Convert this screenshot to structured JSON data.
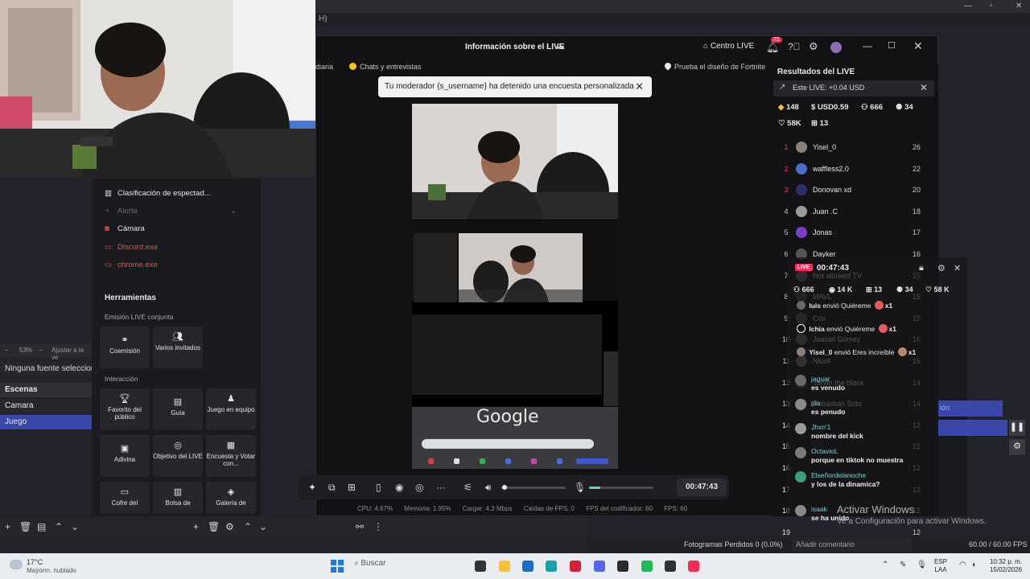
{
  "obs": {
    "menu_fragment": "H)",
    "zoom_value": "53%",
    "zoom_label": "Ajustar a la ve",
    "no_source": "Ninguna fuente seleccionad",
    "scenes_header": "Escenas",
    "scenes": [
      "Camara",
      "Juego"
    ],
    "frames_lost": "Fotogramas Perdidos 0 (0.0%)",
    "fps": "60.00 / 60.00 FPS",
    "right_blue_fragment": "ión"
  },
  "studio": {
    "title": "Información sobre el LIVE",
    "centro_live": "Centro LIVE",
    "notif_count": "71",
    "tags": {
      "diaria": "diaria",
      "chats": "Chats y entrevistas",
      "fortnite": "Prueba el diseño de Fortnite"
    },
    "toast": "Tu moderador {s_username} ha detenido una encuesta personalizada",
    "google_text": "Google",
    "timer": "00:47:43",
    "stats": {
      "cpu": "CPU: 4.67%",
      "memoria": "Memoria: 1.95%",
      "cargar": "Cargar: 4.3 Mbps",
      "caidas": "Caídas de FPS: 0",
      "fps_cod": "FPS del codificador: 60",
      "fps": "FPS: 60"
    }
  },
  "sources": [
    {
      "label": "Clasificación de espectad...",
      "icon": "ranking-icon",
      "color": "#e8e8ea"
    },
    {
      "label": "Alerta",
      "icon": "bell-icon",
      "color": "#6a6a72"
    },
    {
      "label": "Cámara",
      "icon": "camera-icon",
      "color": "#e8e8ea"
    },
    {
      "label": "Discord.exe",
      "icon": "window-icon",
      "color": "#e0504f"
    },
    {
      "label": "chrome.exe",
      "icon": "window-icon",
      "color": "#e0504f"
    }
  ],
  "tools": {
    "title": "Herramientas",
    "section_joint": "Emisión LIVE conjunta",
    "section_interaction": "Interacción",
    "tiles": [
      {
        "label": "Coemisión",
        "icon": "link-icon"
      },
      {
        "label": "Varios invitados",
        "icon": "users-icon"
      },
      {
        "label": "Favorito del público",
        "icon": "trophy-icon"
      },
      {
        "label": "Guía",
        "icon": "guide-icon"
      },
      {
        "label": "Juego en equipo",
        "icon": "team-icon"
      },
      {
        "label": "Adivina",
        "icon": "guess-icon"
      },
      {
        "label": "Objetivo del LIVE",
        "icon": "target-icon"
      },
      {
        "label": "Encuesta y Votar con...",
        "icon": "poll-icon"
      },
      {
        "label": "Cofre del",
        "icon": "chest-icon"
      },
      {
        "label": "Bolsa de",
        "icon": "bag-icon"
      },
      {
        "label": "Galería de",
        "icon": "gallery-icon"
      }
    ]
  },
  "results": {
    "title": "Resultados del LIVE",
    "este_live": "Este LIVE: +0.04 USD",
    "diamonds": "148",
    "usd": "USD0.59",
    "viewers": "666",
    "gifters": "34",
    "likes": "58K",
    "gifts": "13",
    "ranking": [
      {
        "rank": "1",
        "name": "Yisel_0",
        "score": "26",
        "rank_color": "#fe2c55",
        "avatar": "#8a7f7a"
      },
      {
        "rank": "2",
        "name": "waffless2.0",
        "score": "22",
        "rank_color": "#fe2c55",
        "avatar": "#4a6cc8"
      },
      {
        "rank": "3",
        "name": "Donovan xd",
        "score": "20",
        "rank_color": "#fe2c55",
        "avatar": "#2b2f6a"
      },
      {
        "rank": "4",
        "name": "Juan .C",
        "score": "18",
        "rank_color": "#c6c6cc",
        "avatar": "#9a9a9a"
      },
      {
        "rank": "5",
        "name": "Jonas",
        "score": "17",
        "rank_color": "#c6c6cc",
        "avatar": "#7d3fc7"
      },
      {
        "rank": "6",
        "name": "Dayker",
        "score": "16",
        "rank_color": "#c6c6cc",
        "avatar": "#555"
      },
      {
        "rank": "7",
        "name": "Not allowed TV",
        "score": "15",
        "rank_color": "#c6c6cc",
        "avatar": "#666"
      },
      {
        "rank": "8",
        "name": "MAVL",
        "score": "15",
        "rank_color": "#c6c6cc",
        "avatar": "#444"
      },
      {
        "rank": "9",
        "name": "Cris",
        "score": "15",
        "rank_color": "#c6c6cc",
        "avatar": "#555"
      },
      {
        "rank": "10",
        "name": "Jaasiel Gómez",
        "score": "15",
        "rank_color": "#c6c6cc",
        "avatar": "#6a6a6a"
      },
      {
        "rank": "11",
        "name": "Nicoll",
        "score": "15",
        "rank_color": "#c6c6cc",
        "avatar": "#777"
      },
      {
        "rank": "12",
        "name": "Yorvin the black",
        "score": "14",
        "rank_color": "#c6c6cc",
        "avatar": "#555"
      },
      {
        "rank": "13",
        "name": "Sebastián Soto",
        "score": "14",
        "rank_color": "#c6c6cc",
        "avatar": "#666"
      },
      {
        "rank": "14",
        "name": "",
        "score": "12",
        "rank_color": "#c6c6cc",
        "avatar": "#555"
      },
      {
        "rank": "15",
        "name": "",
        "score": "12",
        "rank_color": "#c6c6cc",
        "avatar": "#555"
      },
      {
        "rank": "16",
        "name": "",
        "score": "12",
        "rank_color": "#c6c6cc",
        "avatar": "#555"
      },
      {
        "rank": "17",
        "name": "",
        "score": "12",
        "rank_color": "#c6c6cc",
        "avatar": "#555"
      },
      {
        "rank": "18",
        "name": "",
        "score": "12",
        "rank_color": "#c6c6cc",
        "avatar": "#555"
      },
      {
        "rank": "19",
        "name": "",
        "score": "12",
        "rank_color": "#c6c6cc",
        "avatar": "#555"
      }
    ]
  },
  "chat": {
    "live_badge": "LIVE",
    "time": "00:47:43",
    "viewers": "666",
    "views": "14 K",
    "gifts": "13",
    "gifters": "34",
    "likes": "58 K",
    "gift_events": [
      {
        "user": "luis",
        "text": "envió Quiéreme",
        "count": "x1"
      },
      {
        "user": "Ichia",
        "text": "envió Quiéreme",
        "count": "x1"
      },
      {
        "user": "Yisel_0",
        "text": "envió Eres increíble",
        "count": "x1"
      }
    ],
    "messages": [
      {
        "user": "jaguar",
        "text": "es venudo",
        "avatar": "#6a6a6a"
      },
      {
        "user": "pio",
        "text": "es penudo",
        "avatar": "#8a8a8a"
      },
      {
        "user": "Jhxn'1",
        "text": "nombre del kick",
        "avatar": "#9a9a9a"
      },
      {
        "user": "OctavioL",
        "text": "porque en tiktok no muestra",
        "avatar": "#7a7a7a"
      },
      {
        "user": "Elseñordelanoche",
        "text": "y los de la dinamica?",
        "avatar": "#3aa07a"
      },
      {
        "user": "isaak",
        "text": "se ha unido",
        "avatar": "#888"
      }
    ],
    "input_placeholder": "Añadir comentario"
  },
  "watermark": {
    "line1": "Activar Windows",
    "line2": "Ve a Configuración para activar Windows."
  },
  "taskbar": {
    "temp": "17°C",
    "weather": "Mayorm. nublado",
    "search": "Buscar",
    "lang1": "ESP",
    "lang2": "LAA",
    "time": "10:32 p. m.",
    "date": "15/02/2026",
    "apps": [
      {
        "icon": "file-explorer-icon",
        "color": "#f2c23a"
      },
      {
        "icon": "outlook-icon",
        "color": "#1b6fc9"
      },
      {
        "icon": "edge-icon",
        "color": "#1aa0a6"
      },
      {
        "icon": "opera-icon",
        "color": "#d4203a"
      },
      {
        "icon": "discord-icon",
        "color": "#5865f2"
      },
      {
        "icon": "epic-icon",
        "color": "#2b2b2b"
      },
      {
        "icon": "spotify-icon",
        "color": "#1db954"
      },
      {
        "icon": "obs-icon",
        "color": "#303030"
      },
      {
        "icon": "tiktok-icon",
        "color": "#fe2c55"
      }
    ]
  }
}
